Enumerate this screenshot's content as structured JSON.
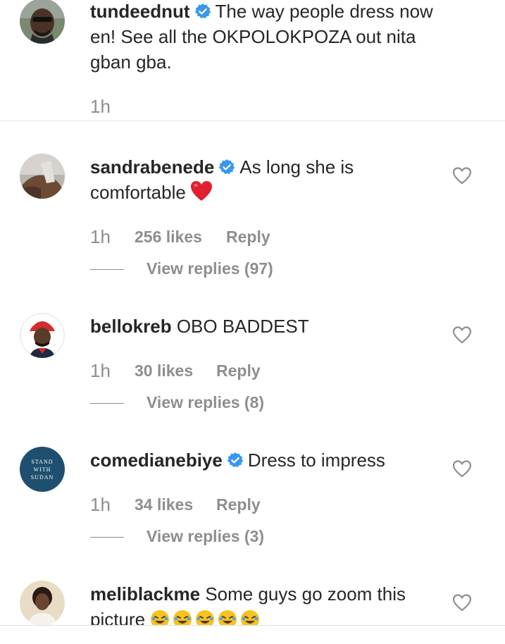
{
  "comments": [
    {
      "username": "tundeednut",
      "verified": true,
      "text": "The way people dress now en! See all the OKPOLOKPOZA out nita gban gba.",
      "time": "1h"
    },
    {
      "username": "sandrabenede",
      "verified": true,
      "text": "As long she is comfortable",
      "emoji": "red-heart",
      "time": "1h",
      "likes": "256 likes",
      "reply": "Reply",
      "view_replies": "View replies (97)"
    },
    {
      "username": "bellokreb",
      "verified": false,
      "text": "OBO BADDEST",
      "time": "1h",
      "likes": "30 likes",
      "reply": "Reply",
      "view_replies": "View replies (8)"
    },
    {
      "username": "comedianebiye",
      "verified": true,
      "text": "Dress to impress",
      "time": "1h",
      "likes": "34 likes",
      "reply": "Reply",
      "view_replies": "View replies (3)",
      "avatar_text": [
        "STAND",
        "WITH",
        "SUDAN"
      ]
    },
    {
      "username": "meliblackme",
      "verified": false,
      "text": "Some guys go zoom this picture",
      "emoji": "rolling-on-floor-laughing x5"
    }
  ],
  "colors": {
    "text": "#262626",
    "secondary": "#8e8e8e",
    "verified_blue": "#3897f0",
    "heart_red": "#e0202e",
    "divider": "#e6e6e6"
  }
}
